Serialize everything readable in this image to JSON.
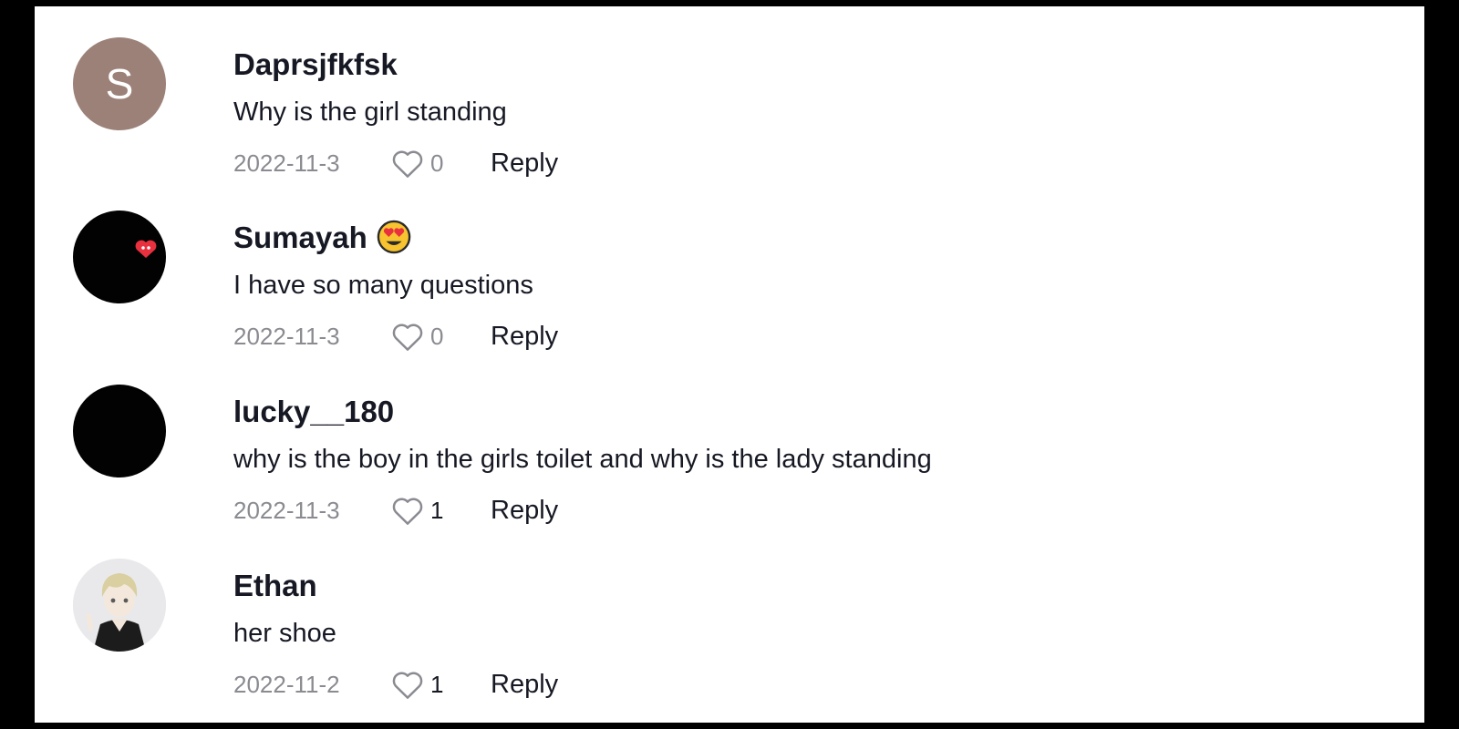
{
  "comments": [
    {
      "username": "Daprsjfkfsk",
      "avatar_letter": "S",
      "avatar_color": "#9c8178",
      "text": "Why is the girl standing",
      "date": "2022-11-3",
      "likes": "0",
      "reply_label": "Reply"
    },
    {
      "username": "Sumayah",
      "username_emoji_icon": "heart-eyes-emoji-icon",
      "avatar_icon": "red-heart-icon",
      "text": "I have so many questions",
      "date": "2022-11-3",
      "likes": "0",
      "reply_label": "Reply"
    },
    {
      "username": "lucky__180",
      "text": "why is the boy in the girls toilet and why is the lady standing",
      "date": "2022-11-3",
      "likes": "1",
      "reply_label": "Reply"
    },
    {
      "username": "Ethan",
      "avatar_icon": "anime-character-avatar",
      "text": "her shoe",
      "date": "2022-11-2",
      "likes": "1",
      "reply_label": "Reply"
    }
  ],
  "icons": {
    "like": "heart-outline-icon"
  },
  "colors": {
    "background": "#ffffff",
    "frame": "#000000",
    "username_text": "#161823",
    "muted_text": "#8a8b91"
  }
}
